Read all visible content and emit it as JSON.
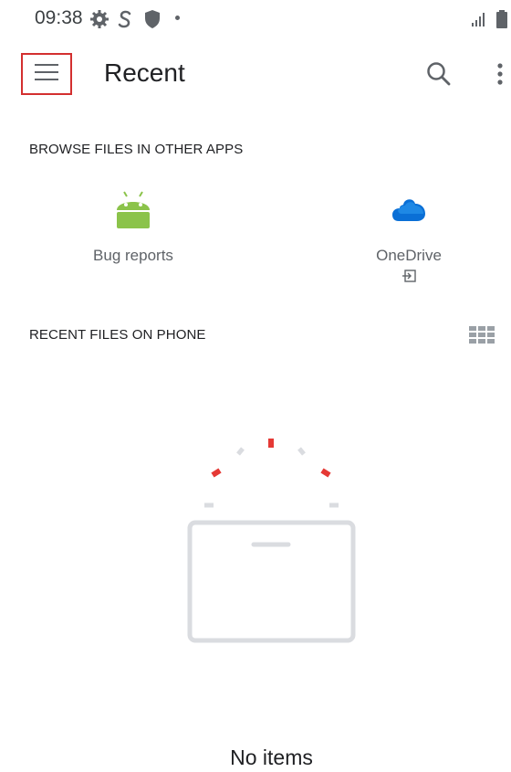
{
  "status_bar": {
    "time": "09:38",
    "icons": [
      "gear-icon",
      "s-sync-icon",
      "shield-icon",
      "signal-icon",
      "battery-icon"
    ]
  },
  "app_bar": {
    "menu_icon": "hamburger-menu-icon",
    "title": "Recent",
    "actions": [
      "search-icon",
      "more-vert-icon"
    ]
  },
  "browse_section": {
    "heading": "BROWSE FILES IN OTHER APPS",
    "apps": [
      {
        "label": "Bug reports",
        "icon": "android-icon",
        "color": "#8bc34a"
      },
      {
        "label": "OneDrive",
        "icon": "onedrive-cloud-icon",
        "color": "#0a6fd6",
        "sub_icon": "open-external-icon"
      }
    ]
  },
  "recent_section": {
    "heading": "RECENT FILES ON PHONE",
    "view_toggle_icon": "grid-view-icon"
  },
  "empty_state": {
    "text": "No items",
    "illustration": "empty-folder-illustration"
  },
  "colors": {
    "accent": "#d32f2f",
    "gray_text": "#5f6368",
    "illustration_gray": "#dadce0"
  }
}
